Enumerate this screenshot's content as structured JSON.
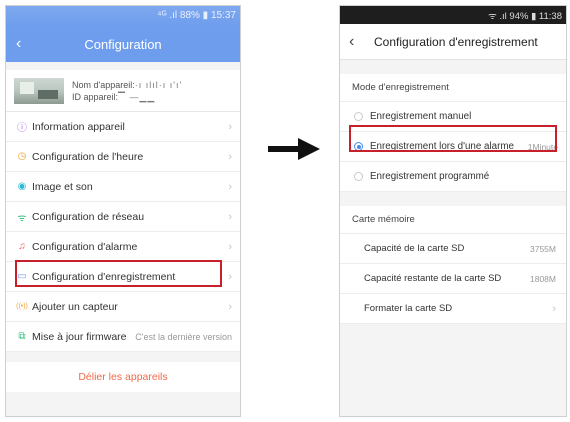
{
  "left": {
    "status_text": "⁴ᴳ .ıl 88% ▮ 15:37",
    "title": "Configuration",
    "device": {
      "name_label": "Nom d'appareil:",
      "name_value": "·ı ılıl·ı ı'ı'",
      "id_label": "ID appareil:",
      "id_value": "▔ —▁▁"
    },
    "menu": [
      {
        "icon": "ⓘ",
        "label": "Information appareil"
      },
      {
        "icon": "◷",
        "label": "Configuration de l'heure"
      },
      {
        "icon": "◉",
        "label": "Image et son"
      },
      {
        "icon": "ᯤ",
        "label": "Configuration de réseau"
      },
      {
        "icon": "♫",
        "label": "Configuration d'alarme"
      },
      {
        "icon": "▭",
        "label": "Configuration d'enregistrement"
      },
      {
        "icon": "((•))",
        "label": "Ajouter un capteur"
      }
    ],
    "firmware": {
      "label": "Mise à jour firmware",
      "status": "C'est la dernière version"
    },
    "unbind_label": "Délier les appareils"
  },
  "right": {
    "status_text": "ᯤ .ıl 94% ▮ 11:38",
    "title": "Configuration d'enregistrement",
    "mode_section": "Mode d'enregistrement",
    "modes": [
      {
        "label": "Enregistrement manuel",
        "value": "",
        "selected": false
      },
      {
        "label": "Enregistrement lors d'une alarme",
        "value": "1Minute",
        "selected": true
      },
      {
        "label": "Enregistrement programmé",
        "value": "",
        "selected": false
      }
    ],
    "memory_section": "Carte mémoire",
    "memory": [
      {
        "label": "Capacité de la carte SD",
        "value": "3755M"
      },
      {
        "label": "Capacité restante de la carte SD",
        "value": "1808M"
      },
      {
        "label": "Formater la carte SD",
        "value": ""
      }
    ]
  },
  "colors": {
    "header_blue": "#6f9ded",
    "highlight_red": "#c8202a",
    "unbind_orange": "#f06a4a",
    "radio_blue": "#4a8be8"
  },
  "icons": {
    "back": "back-chevron-icon",
    "chevron": "chevron-right-icon",
    "arrow": "right-arrow-icon"
  }
}
